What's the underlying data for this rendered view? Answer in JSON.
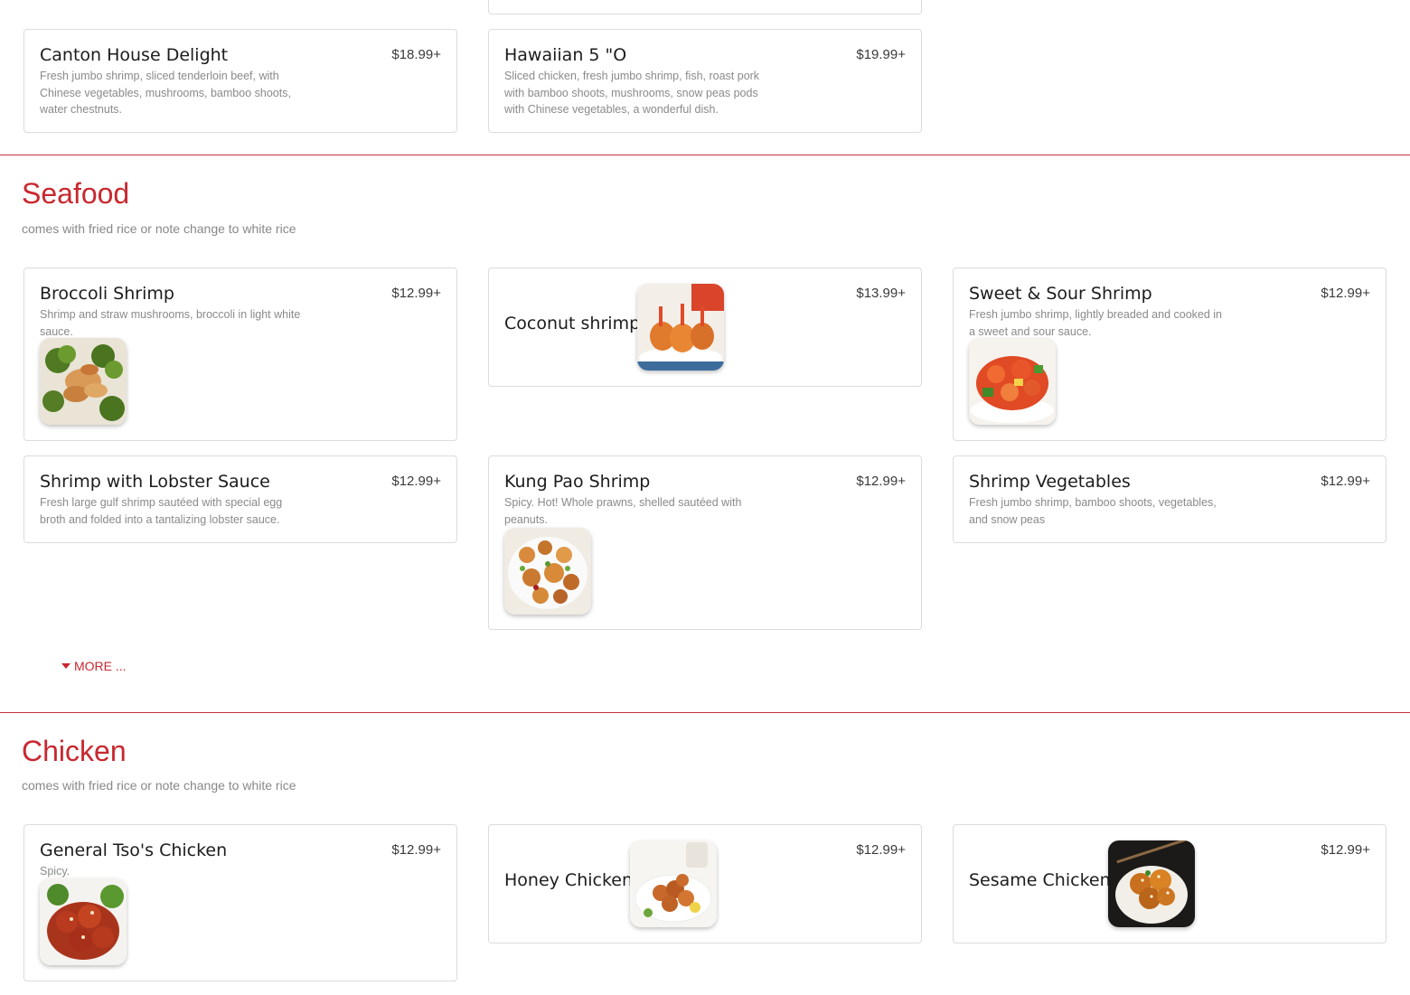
{
  "top_items": [
    {
      "name": "Canton House Delight",
      "price": "$18.99+",
      "desc": "Fresh jumbo shrimp, sliced tenderloin beef, with Chinese vegetables, mushrooms, bamboo shoots, water chestnuts."
    },
    {
      "name": "Hawaiian 5 \"O",
      "price": "$19.99+",
      "desc": "Sliced chicken, fresh jumbo shrimp, fish, roast pork with bamboo shoots, mushrooms, snow peas pods with Chinese vegetables, a wonderful dish."
    }
  ],
  "seafood": {
    "title": "Seafood",
    "subtitle": "comes with fried rice or note change to white rice",
    "items": [
      {
        "name": "Broccoli Shrimp",
        "price": "$12.99+",
        "desc": "Shrimp and straw mushrooms, broccoli in light white sauce.",
        "image": "broccoli-shrimp-photo"
      },
      {
        "name": "Coconut shrimp",
        "price": "$13.99+",
        "image": "coconut-shrimp-photo"
      },
      {
        "name": "Sweet & Sour Shrimp",
        "price": "$12.99+",
        "desc": "Fresh jumbo shrimp, lightly breaded and cooked in a sweet and sour sauce.",
        "image": "sweet-sour-shrimp-photo"
      },
      {
        "name": "Shrimp with Lobster Sauce",
        "price": "$12.99+",
        "desc": "Fresh large gulf shrimp sautéed with special egg broth and folded into a tantalizing lobster sauce."
      },
      {
        "name": "Kung Pao Shrimp",
        "price": "$12.99+",
        "desc": "Spicy. Hot! Whole prawns, shelled sautéed with peanuts.",
        "image": "kung-pao-shrimp-photo"
      },
      {
        "name": "Shrimp Vegetables",
        "price": "$12.99+",
        "desc": "Fresh jumbo shrimp, bamboo shoots, vegetables, and snow peas"
      }
    ],
    "more_label": "MORE ..."
  },
  "chicken": {
    "title": "Chicken",
    "subtitle": "comes with fried rice or note change to white rice",
    "items": [
      {
        "name": "General Tso's Chicken",
        "price": "$12.99+",
        "desc": "Spicy.",
        "image": "general-tso-chicken-photo"
      },
      {
        "name": "Honey Chicken",
        "price": "$12.99+",
        "image": "honey-chicken-photo"
      },
      {
        "name": "Sesame Chicken",
        "price": "$12.99+",
        "image": "sesame-chicken-photo"
      }
    ]
  },
  "colors": {
    "accent": "#c8282f",
    "divider": "#c6323b",
    "card_border": "#dcdcdc",
    "desc_text": "#8a8a8a"
  }
}
